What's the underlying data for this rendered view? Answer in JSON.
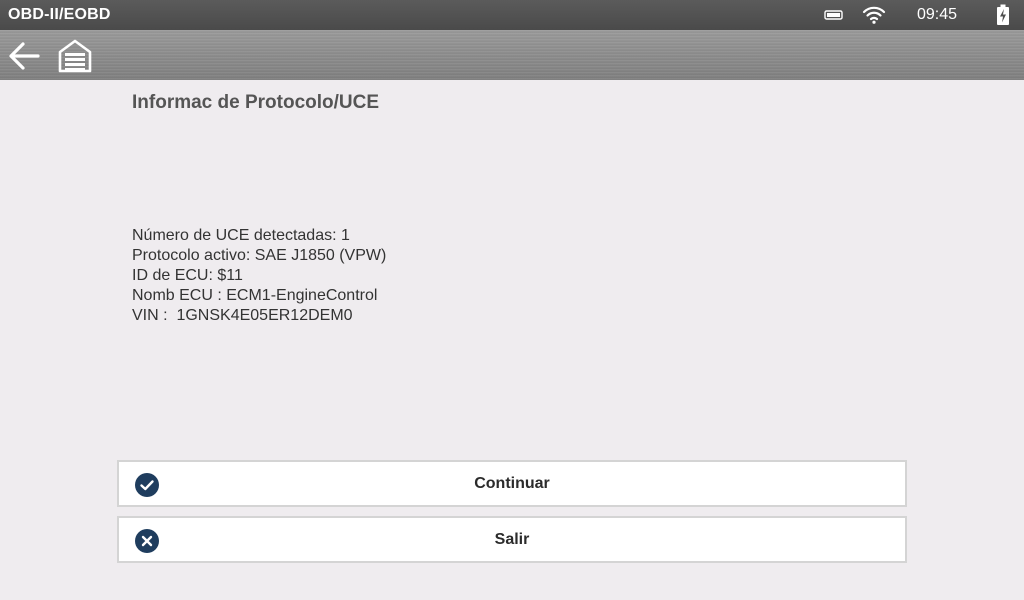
{
  "statusbar": {
    "app_title": "OBD-II/EOBD",
    "time": "09:45",
    "icons": [
      "battery-small-icon",
      "wifi-icon",
      "battery-charging-icon"
    ]
  },
  "toolbar": {
    "icons": [
      "back-arrow-icon",
      "home-garage-icon"
    ]
  },
  "page": {
    "title": "Informac de Protocolo/UCE",
    "info_lines": [
      "Número de UCE detectadas: 1",
      "Protocolo activo: SAE J1850 (VPW)",
      "ID de ECU: $11",
      "Nomb ECU : ECM1-EngineControl",
      "VIN :  1GNSK4E05ER12DEM0"
    ]
  },
  "actions": {
    "continue_label": "Continuar",
    "exit_label": "Salir"
  },
  "colors": {
    "background": "#efecef",
    "statusbar": "#4f4f4f",
    "toolbar": "#8c8c8c",
    "icon_accent": "#1f3d5e"
  }
}
